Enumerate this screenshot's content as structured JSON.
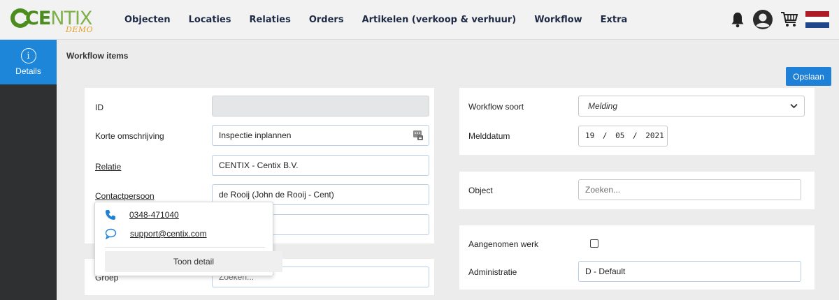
{
  "app": {
    "logo_text_bold": "CE",
    "logo_text_light": "NTIX",
    "logo_sub": "DEMO"
  },
  "nav": {
    "items": [
      "Objecten",
      "Locaties",
      "Relaties",
      "Orders",
      "Artikelen (verkoop & verhuur)",
      "Workflow",
      "Extra"
    ]
  },
  "top_icons": [
    "bell-icon",
    "user-avatar-icon",
    "cart-icon",
    "dutch-flag-icon"
  ],
  "sidebar": {
    "items": [
      {
        "label": "Details",
        "icon": "info-icon"
      }
    ]
  },
  "page": {
    "title": "Workflow items",
    "save_label": "Opslaan"
  },
  "form_left": {
    "id_label": "ID",
    "id_value": "",
    "desc_label": "Korte omschrijving",
    "desc_value": "Inspectie inplannen",
    "relatie_label": "Relatie",
    "relatie_value": "CENTIX - Centix B.V.",
    "contact_label": "Contactpersoon",
    "contact_value": "de Rooij (John de Rooij - Cent)",
    "groep_label": "Groep",
    "groep_placeholder": "Zoeken..."
  },
  "contact_popup": {
    "phone": "0348-471040",
    "email": "support@centix.com",
    "detail_button": "Toon detail"
  },
  "form_right": {
    "soort_label": "Workflow soort",
    "soort_value": "Melding",
    "melddatum_label": "Melddatum",
    "melddatum_day": "19",
    "melddatum_month": "05",
    "melddatum_year": "2021",
    "object_label": "Object",
    "object_placeholder": "Zoeken...",
    "aangenomen_label": "Aangenomen werk",
    "aangenomen_checked": false,
    "administratie_label": "Administratie",
    "administratie_value": "D - Default"
  },
  "colors": {
    "accent": "#1e80d6",
    "sidebar_bg": "#2f3032",
    "logo_green": "#4d8c1e",
    "logo_demo": "#e3a12b"
  }
}
